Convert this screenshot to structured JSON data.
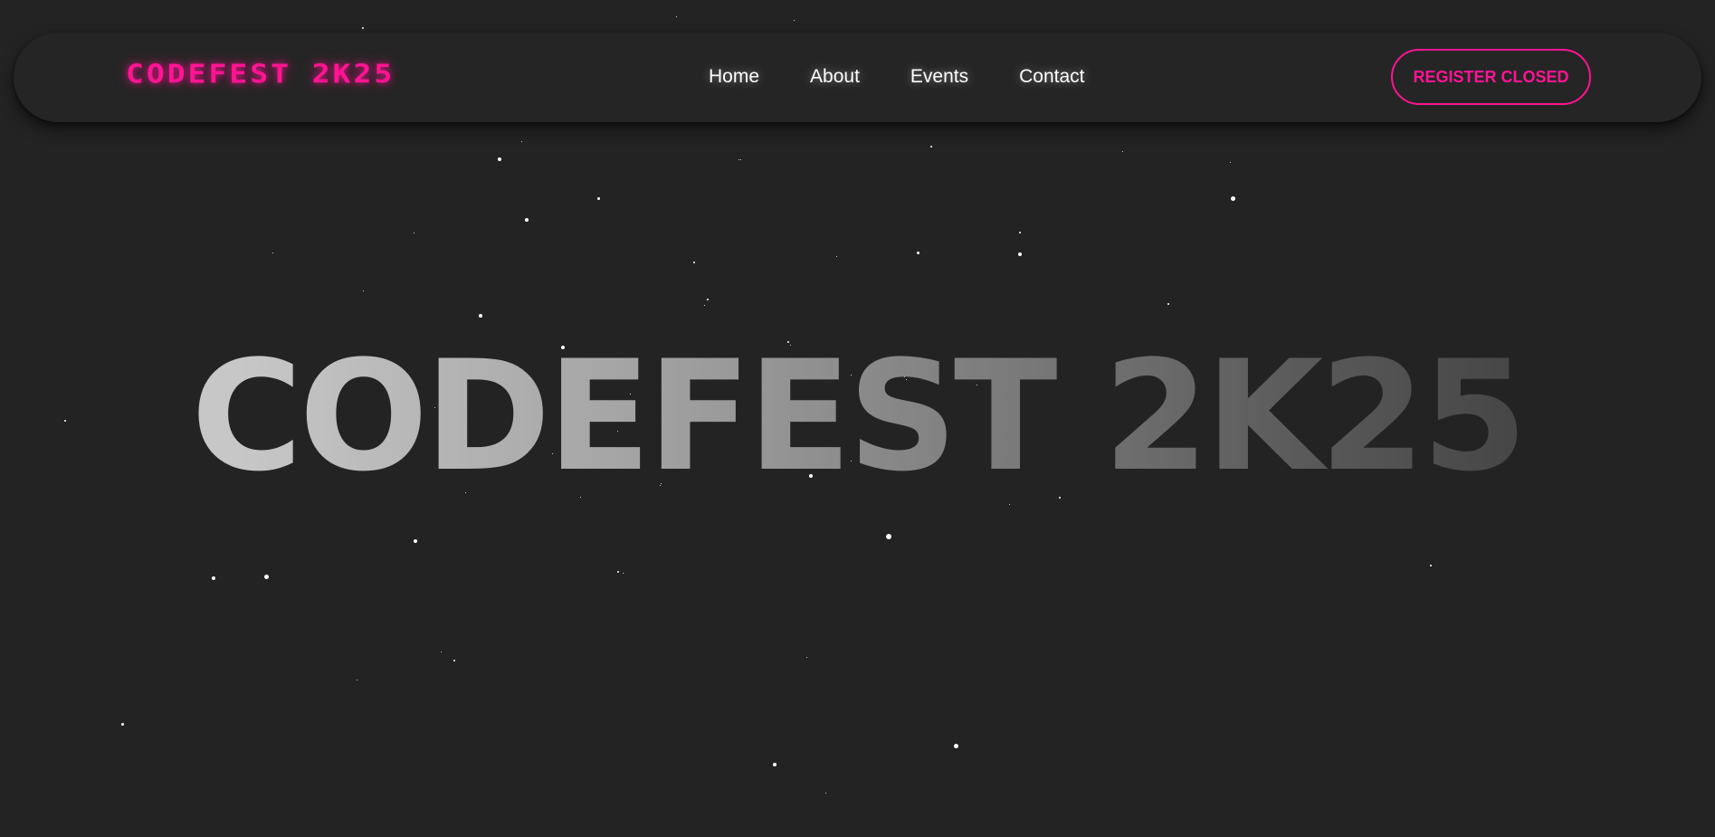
{
  "brand": {
    "logo_text": "CODEFEST 2K25",
    "accent_color": "#ff1493"
  },
  "nav": {
    "links": [
      {
        "label": "Home"
      },
      {
        "label": "About"
      },
      {
        "label": "Events"
      },
      {
        "label": "Contact"
      }
    ]
  },
  "register": {
    "label": "REGISTER CLOSED"
  },
  "hero": {
    "title": "CODEFEST 2K25"
  },
  "colors": {
    "background": "#232323",
    "navbar": "#252525",
    "nav_text": "#ffffff",
    "star": "#ffffff"
  }
}
